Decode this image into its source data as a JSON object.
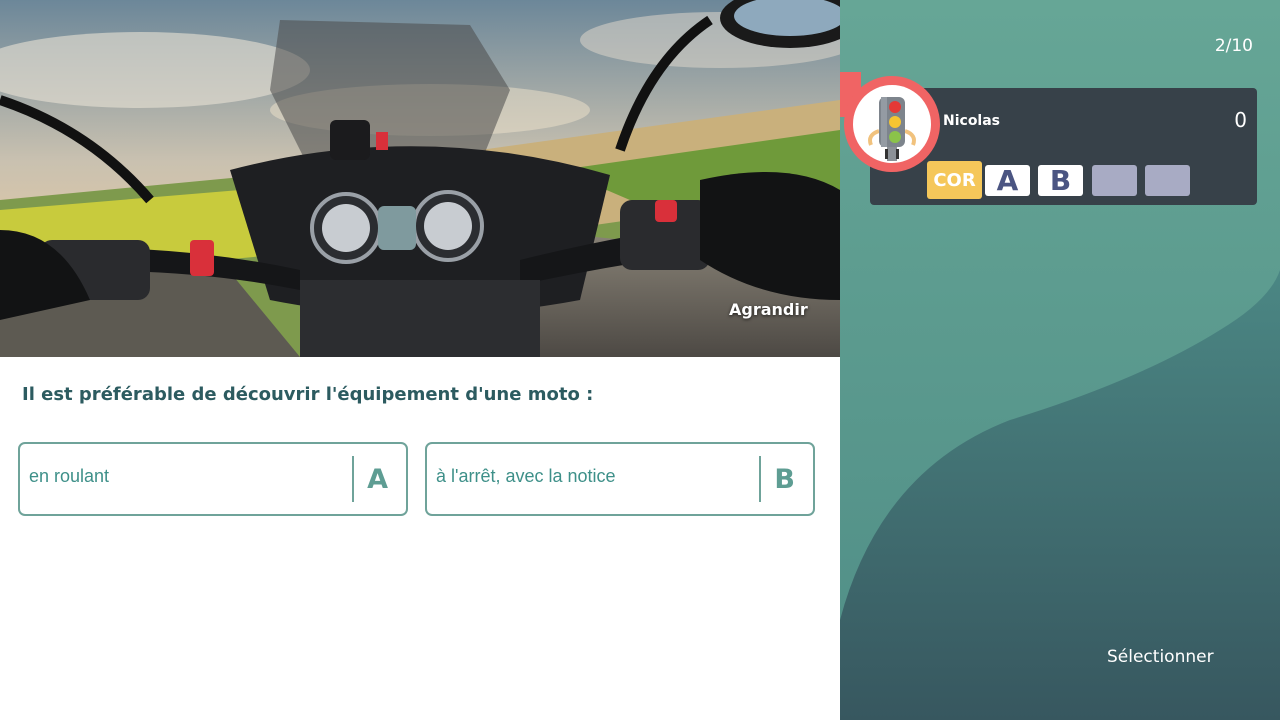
{
  "image": {
    "enlarge_label": "Agrandir"
  },
  "quiz": {
    "question": "Il est préférable de découvrir l'équipement d'une moto :",
    "answers": [
      {
        "letter": "A",
        "text": "en roulant"
      },
      {
        "letter": "B",
        "text": "à l'arrêt, avec la notice"
      }
    ]
  },
  "panel": {
    "progress": "2/10",
    "player": {
      "name": "Nicolas",
      "score": "0",
      "avatar_icon": "traffic-light-icon",
      "slots": [
        {
          "label": "COR",
          "state": "correction"
        },
        {
          "label": "A",
          "state": "filled"
        },
        {
          "label": "B",
          "state": "filled"
        },
        {
          "label": "",
          "state": "empty"
        },
        {
          "label": "",
          "state": "empty"
        }
      ]
    },
    "select_label": "Sélectionner"
  },
  "colors": {
    "panel_green": "#62a194",
    "panel_dark": "#355761",
    "card_bg": "#374149",
    "accent_red": "#f06464",
    "cor_yellow": "#f5c75a",
    "slot_empty": "#a8abc4",
    "letter_navy": "#4b5582",
    "question_text": "#2c5b60",
    "answer_border": "#6fa39a"
  }
}
